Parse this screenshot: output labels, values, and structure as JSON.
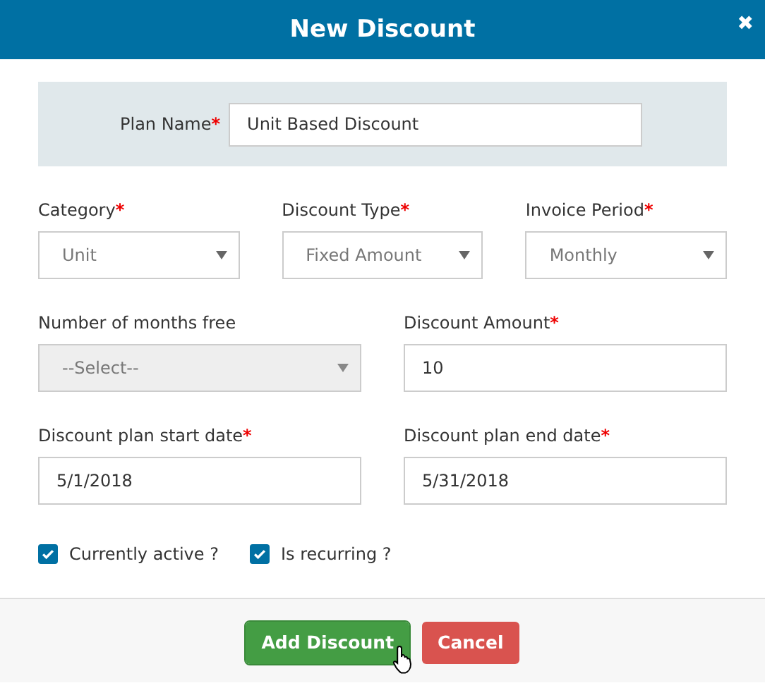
{
  "dialog": {
    "title": "New Discount",
    "close": "✖"
  },
  "plan_name": {
    "label": "Plan Name",
    "required_mark": "*",
    "value": "Unit Based Discount"
  },
  "rows": [
    {
      "fields": [
        {
          "kind": "select",
          "label": "Category",
          "required_mark": "*",
          "value": "Unit",
          "disabled": false
        },
        {
          "kind": "select",
          "label": "Discount Type",
          "required_mark": "*",
          "value": "Fixed Amount",
          "disabled": false
        },
        {
          "kind": "select",
          "label": "Invoice Period",
          "required_mark": "*",
          "value": "Monthly",
          "disabled": false
        }
      ]
    },
    {
      "fields": [
        {
          "kind": "select",
          "label": "Number of months free",
          "value": "--Select--",
          "disabled": true
        },
        {
          "kind": "text",
          "label": "Discount Amount",
          "required_mark": "*",
          "value": "10",
          "disabled": false
        }
      ]
    },
    {
      "fields": [
        {
          "kind": "text",
          "label": "Discount plan start date",
          "required_mark": "*",
          "value": "5/1/2018",
          "disabled": false
        },
        {
          "kind": "text",
          "label": "Discount plan end date",
          "required_mark": "*",
          "value": "5/31/2018",
          "disabled": false
        }
      ]
    }
  ],
  "checkboxes": [
    {
      "label": "Currently active ?",
      "checked": true
    },
    {
      "label": "Is recurring ?",
      "checked": true
    }
  ],
  "buttons": [
    {
      "label": "Add Discount",
      "kind": "primary",
      "hovered": true
    },
    {
      "label": "Cancel",
      "kind": "danger",
      "hovered": false
    }
  ]
}
